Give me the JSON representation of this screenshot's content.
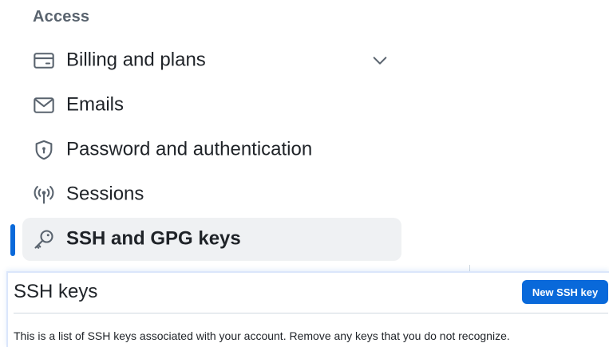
{
  "sidebar": {
    "section_heading": "Access",
    "items": [
      {
        "label": "Billing and plans",
        "icon": "credit-card-icon",
        "expandable": true
      },
      {
        "label": "Emails",
        "icon": "mail-icon"
      },
      {
        "label": "Password and authentication",
        "icon": "shield-lock-icon"
      },
      {
        "label": "Sessions",
        "icon": "broadcast-icon"
      },
      {
        "label": "SSH and GPG keys",
        "icon": "key-icon",
        "active": true
      }
    ],
    "active_color": "#0969da"
  },
  "ssh_panel": {
    "title": "SSH keys",
    "new_button_label": "New SSH key",
    "description": "This is a list of SSH keys associated with your account. Remove any keys that you do not recognize.",
    "button_color": "#0969da"
  }
}
